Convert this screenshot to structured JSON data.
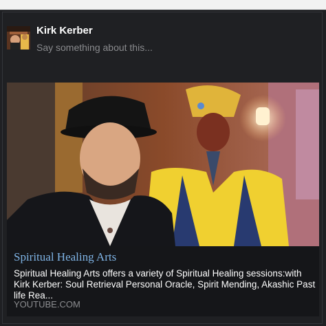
{
  "post": {
    "author_name": "Kirk Kerber",
    "compose_placeholder": "Say something about this..."
  },
  "link_card": {
    "title": "Spiritual Healing Arts",
    "description": "Spiritual Healing Arts offers a variety of Spiritual Healing sessions:with Kirk Kerber: Soul Retrieval Personal Oracle, Spirit Mending, Akashic Past life Rea...",
    "domain": "YOUTUBE.COM"
  },
  "colors": {
    "background": "#1f2023",
    "title_link": "#7fb4e6",
    "muted_text": "#8a8b8e"
  }
}
